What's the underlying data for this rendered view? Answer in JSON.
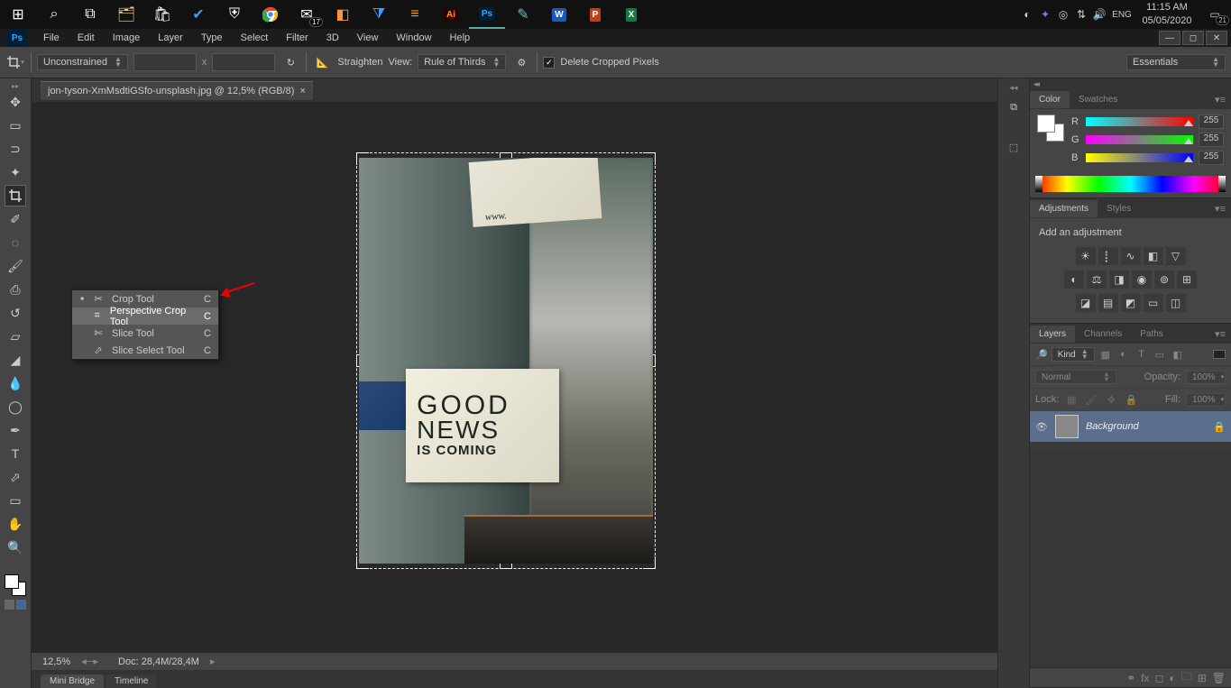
{
  "taskbar": {
    "clock_time": "11:15 AM",
    "clock_date": "05/05/2020",
    "lang": "ENG",
    "mail_badge": "17",
    "notif_badge": "21"
  },
  "menubar": {
    "file": "File",
    "edit": "Edit",
    "image": "Image",
    "layer": "Layer",
    "type": "Type",
    "select": "Select",
    "filter": "Filter",
    "threeD": "3D",
    "view": "View",
    "window": "Window",
    "help": "Help"
  },
  "options": {
    "ratio": "Unconstrained",
    "x_label": "x",
    "straighten": "Straighten",
    "view_label": "View:",
    "view_value": "Rule of Thirds",
    "delete_label": "Delete Cropped Pixels",
    "workspace": "Essentials"
  },
  "document": {
    "tab_title": "jon-tyson-XmMsdtiGSfo-unsplash.jpg @ 12,5% (RGB/8)"
  },
  "flyout": {
    "crop": "Crop Tool",
    "perspective": "Perspective Crop Tool",
    "slice": "Slice Tool",
    "slice_select": "Slice Select Tool",
    "short": "C"
  },
  "status": {
    "zoom": "12,5%",
    "doc_label": "Doc:",
    "doc_size": "28,4M/28,4M"
  },
  "footer": {
    "mini_bridge": "Mini Bridge",
    "timeline": "Timeline"
  },
  "panels": {
    "color_tab": "Color",
    "swatches_tab": "Swatches",
    "r_label": "R",
    "g_label": "G",
    "b_label": "B",
    "r_val": "255",
    "g_val": "255",
    "b_val": "255",
    "adjustments_tab": "Adjustments",
    "styles_tab": "Styles",
    "adj_title": "Add an adjustment",
    "layers_tab": "Layers",
    "channels_tab": "Channels",
    "paths_tab": "Paths",
    "kind": "Kind",
    "normal": "Normal",
    "opacity_label": "Opacity:",
    "opacity_val": "100%",
    "lock_label": "Lock:",
    "fill_label": "Fill:",
    "fill_val": "100%",
    "layer_name": "Background"
  },
  "poster": {
    "line1": "GOOD",
    "line2": "NEWS",
    "line3": "IS COMING",
    "www": "www."
  },
  "ps_logo": "Ps"
}
